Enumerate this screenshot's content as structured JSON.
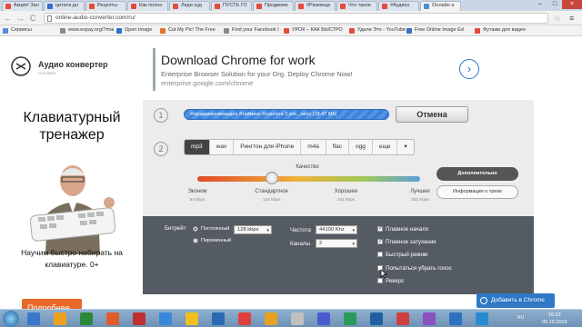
{
  "tabs": [
    {
      "label": "Акция! Зан",
      "color": "#e34b3c"
    },
    {
      "label": "цитата дн",
      "color": "#3a6fc8"
    },
    {
      "label": "Рецепты",
      "color": "#e34b3c"
    },
    {
      "label": "Как полно",
      "color": "#e34b3c"
    },
    {
      "label": "Леди худ",
      "color": "#e34b3c"
    },
    {
      "label": "ПУСТЬ ГО",
      "color": "#e34b3c"
    },
    {
      "label": "Продвиже",
      "color": "#e34b3c"
    },
    {
      "label": "#Размеще",
      "color": "#e34b3c"
    },
    {
      "label": "Что такое",
      "color": "#e34b3c"
    },
    {
      "label": "#Аудиоз",
      "color": "#e34b3c"
    },
    {
      "label": "Онлайн а",
      "color": "#4a90d9"
    }
  ],
  "window_controls": {
    "minimize": "–",
    "maximize": "□",
    "close": "×"
  },
  "address": {
    "url": "online-audio-converter.com/ru/",
    "back": "←",
    "forward": "→",
    "reload": "C",
    "menu": "≡",
    "star": "☆"
  },
  "bookmarks": [
    {
      "label": "Сервисы",
      "color": "#5b8ad6"
    },
    {
      "label": "www.expay.org/?mai",
      "color": "#8a8a8a"
    },
    {
      "label": "Open Image",
      "color": "#2a72c9"
    },
    {
      "label": "Cut My Pic! The Free",
      "color": "#e3742a"
    },
    {
      "label": "Find your Facebook I",
      "color": "#8a8a8a"
    },
    {
      "label": "УРОК – КАК БЫСТРО",
      "color": "#e34b3c"
    },
    {
      "label": "Удали Это - YouTube",
      "color": "#e34b3c"
    },
    {
      "label": "Free Online Image Ed",
      "color": "#3a6fc8"
    },
    {
      "label": "Футажи для видео",
      "color": "#e34b3c"
    }
  ],
  "site": {
    "name": "Аудио конвертер",
    "sub": "cloudsafe"
  },
  "ad_top": {
    "title": "Download Chrome for work",
    "line1": "Enterprise Browser Solution for your Org. Deploy Chrome Now!",
    "line2": "enterprise.google.com/chrome",
    "arrow": "›"
  },
  "ad_left": {
    "title": "Клавиатурный тренажер",
    "text": "Научим быстро набирать на клавиатуре. 0+",
    "button": "Подробнее"
  },
  "step1": {
    "num": "1",
    "file": "#продвижениевидео #тайминг #хэштеги 2.wm...wmv (18.47 Mb)",
    "cancel": "Отмена"
  },
  "step2": {
    "num": "2",
    "formats": [
      "mp3",
      "wav",
      "Рингтон для iPhone",
      "m4a",
      "flac",
      "ogg",
      "еще"
    ],
    "selected_format": "mp3",
    "more_arrow": "▾"
  },
  "quality": {
    "label": "Качество",
    "value_index": 1,
    "levels": [
      {
        "name": "Эконом",
        "rate": "64 kbps"
      },
      {
        "name": "Стандартное",
        "rate": "128 kbps"
      },
      {
        "name": "Хорошее",
        "rate": "192 kbps"
      },
      {
        "name": "Лучшее",
        "rate": "320 kbps"
      }
    ]
  },
  "buttons": {
    "advanced": "Дополнительно",
    "info": "Информация о треке"
  },
  "advanced": {
    "bitrate_label": "Битрейт",
    "constant": "Постоянный",
    "variable": "Переменный",
    "bitrate_value": "128 kbps",
    "frequency_label": "Частота",
    "frequency_value": "44100 Khz",
    "channels_label": "Каналы",
    "channels_value": "2",
    "fade_in": "Плавное начало",
    "fade_out": "Плавное затухание",
    "fast_mode": "Быстрый режим",
    "remove_voice": "Попытаться убрать голос",
    "reverse": "Реверс",
    "fade_in_checked": true,
    "fade_out_checked": true
  },
  "chrome_button": "Добавить в Chrome",
  "taskbar": {
    "lang": "RU",
    "time": "16:32",
    "date": "05.10.2016",
    "icons": [
      "#3c78c8",
      "#f0a020",
      "#2a8a3a",
      "#e05a2a",
      "#c03030",
      "#3a88d8",
      "#f0c020",
      "#2a6ab0",
      "#e04040",
      "#e8a020",
      "#c0c0c0",
      "#4a5ad0",
      "#2a9a5a",
      "#2060a0",
      "#d04040",
      "#8a50c0",
      "#3070c0",
      "#2a8ad0"
    ]
  }
}
